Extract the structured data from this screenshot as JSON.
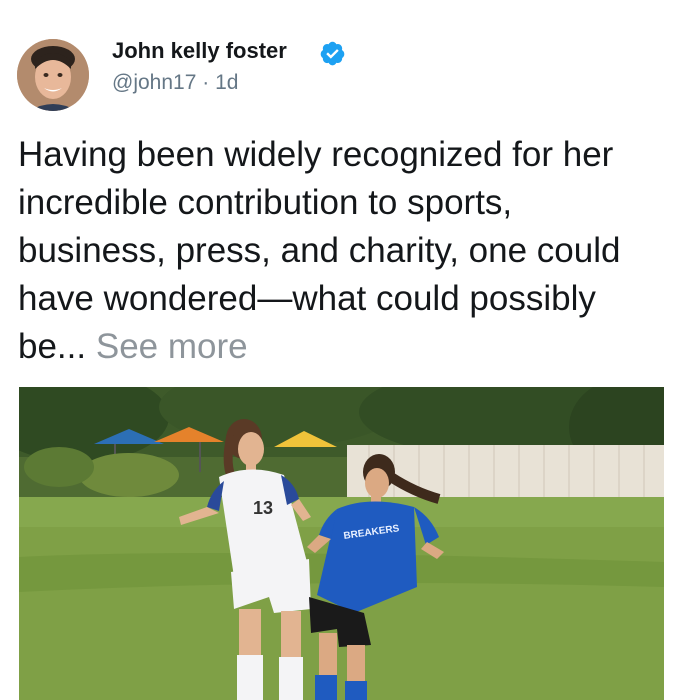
{
  "tweet": {
    "author": {
      "name": "John kelly foster",
      "handle": "@john17",
      "separator": "·",
      "time": "1d",
      "verified": true
    },
    "text_lines": [
      "Having been widely recognized for her",
      "incredible contribution to sports,",
      "business, press, and charity, one could",
      "have wondered—what could possibly",
      "be..."
    ],
    "see_more": "See more",
    "media": {
      "left_jersey_number": "13",
      "right_jersey_text": "BREAKERS"
    }
  },
  "colors": {
    "name_text": "#14171a",
    "secondary_text": "#657786",
    "see_more": "#8e959b",
    "verified_badge": "#1da1f2"
  },
  "icons": {
    "verified": "verified-badge-icon"
  }
}
